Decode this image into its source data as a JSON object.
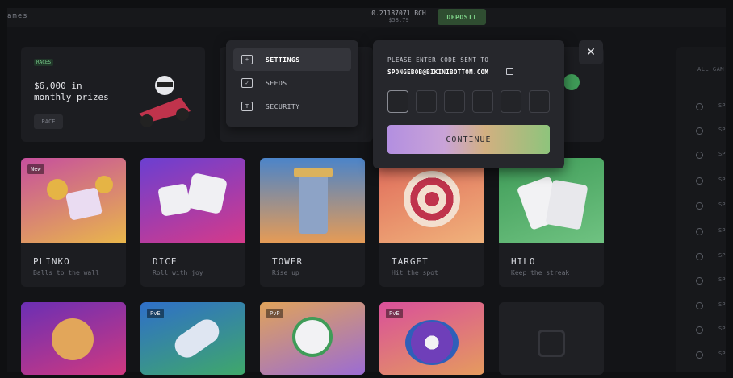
{
  "header": {
    "title": "ames",
    "balance_main": "0.21187071 BCH",
    "balance_sub": "$58.79",
    "deposit_label": "DEPOSIT"
  },
  "promo": {
    "badge": "RACES",
    "headline_1": "$6,000 in",
    "headline_2": "monthly prizes",
    "button": "RACE"
  },
  "settings_menu": {
    "items": [
      {
        "label": "SETTINGS",
        "icon": "settings-icon",
        "active": true
      },
      {
        "label": "SEEDS",
        "icon": "seeds-icon",
        "active": false
      },
      {
        "label": "SECURITY",
        "icon": "security-icon",
        "active": false
      }
    ]
  },
  "verify_modal": {
    "prompt": "PLEASE ENTER CODE SENT TO",
    "email": "SPONGEBOB@BIKINIBOTTOM.COM",
    "code_digits": 6,
    "continue_label": "CONTINUE"
  },
  "games": [
    {
      "name": "PLINKO",
      "desc": "Balls to the wall",
      "tag": "New",
      "colors": [
        "#c64f9e",
        "#e9b64b"
      ]
    },
    {
      "name": "DICE",
      "desc": "Roll with joy",
      "tag": "",
      "colors": [
        "#6b3fd1",
        "#d53a8a"
      ]
    },
    {
      "name": "TOWER",
      "desc": "Rise up",
      "tag": "",
      "colors": [
        "#4b84c9",
        "#e59b56"
      ]
    },
    {
      "name": "TARGET",
      "desc": "Hit the spot",
      "tag": "",
      "colors": [
        "#e06a5a",
        "#f0b27b"
      ]
    },
    {
      "name": "HILO",
      "desc": "Keep the streak",
      "tag": "",
      "colors": [
        "#3f9c58",
        "#6fc281"
      ]
    }
  ],
  "games_row2": [
    {
      "tag": "",
      "colors": [
        "#6b2fb4",
        "#d0397f"
      ]
    },
    {
      "tag": "PvE",
      "colors": [
        "#2f6fc9",
        "#3fa86a"
      ]
    },
    {
      "tag": "PvP",
      "colors": [
        "#e0a35a",
        "#9b6cd3"
      ]
    },
    {
      "tag": "PvE",
      "colors": [
        "#d9509a",
        "#e59b5e"
      ]
    },
    {
      "tag": "",
      "colors": [
        "#1f2024",
        "#1f2024"
      ]
    }
  ],
  "sidebar": {
    "header": "ALL GAM",
    "rows": [
      "SP",
      "SP",
      "SP",
      "SP",
      "SP",
      "SP",
      "SP",
      "SP",
      "SP",
      "SP",
      "SP"
    ]
  }
}
